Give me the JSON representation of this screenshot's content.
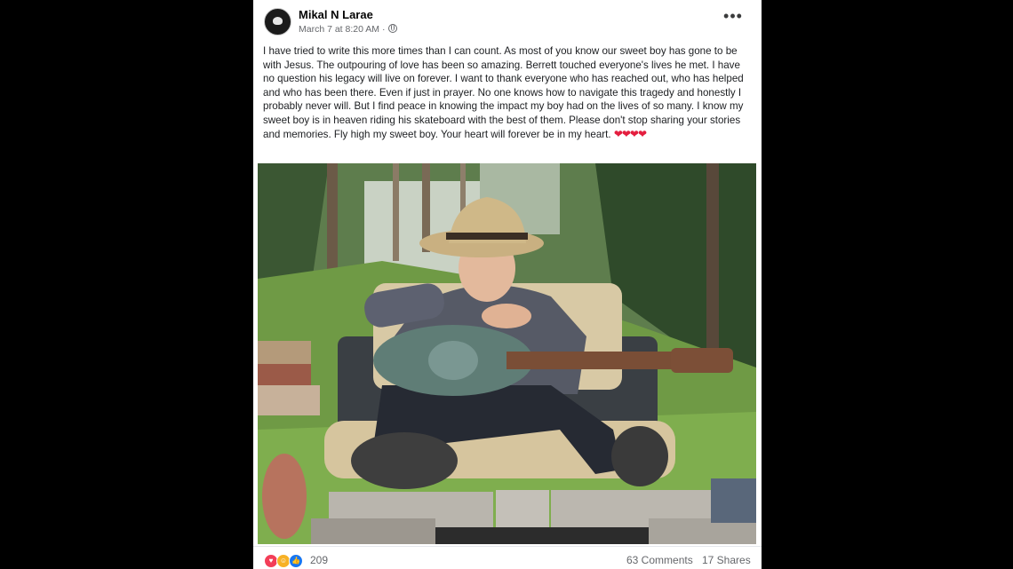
{
  "post": {
    "author": "Mikal N Larae",
    "timestamp": "March 7 at 8:20 AM",
    "separator": "·",
    "privacy_icon": "globe-icon",
    "more_icon": "more-options-icon",
    "body": "I have tried to write this more times than I can count. As most of you know our sweet boy has gone to be with Jesus. The outpouring of love has been so amazing. Berrett touched everyone's lives he met. I have no question his legacy will live on forever. I want to thank everyone who has reached out, who has helped and who has been there. Even if just in prayer. No one knows how to navigate this tragedy and honestly I probably never will. But I find peace in knowing the impact my boy had on the lives of so many. I know my sweet boy is in heaven riding his skateboard with the best of them. Please don't stop sharing your stories and memories. Fly high my sweet boy. Your heart will forever be in my heart.",
    "hearts": "❤❤❤❤",
    "photo": "photo-boy-in-cowboy-hat-with-guitar"
  },
  "footer": {
    "reaction_icons": [
      "love-reaction-icon",
      "care-reaction-icon",
      "like-reaction-icon"
    ],
    "reaction_count": "209",
    "comments": "63 Comments",
    "shares": "17 Shares"
  },
  "colors": {
    "background": "#000000",
    "card": "#ffffff",
    "love": "#f33e58",
    "care": "#f7b125",
    "like": "#1877f2",
    "heart_emoji": "#e41e3f",
    "secondary_text": "#65676b"
  }
}
